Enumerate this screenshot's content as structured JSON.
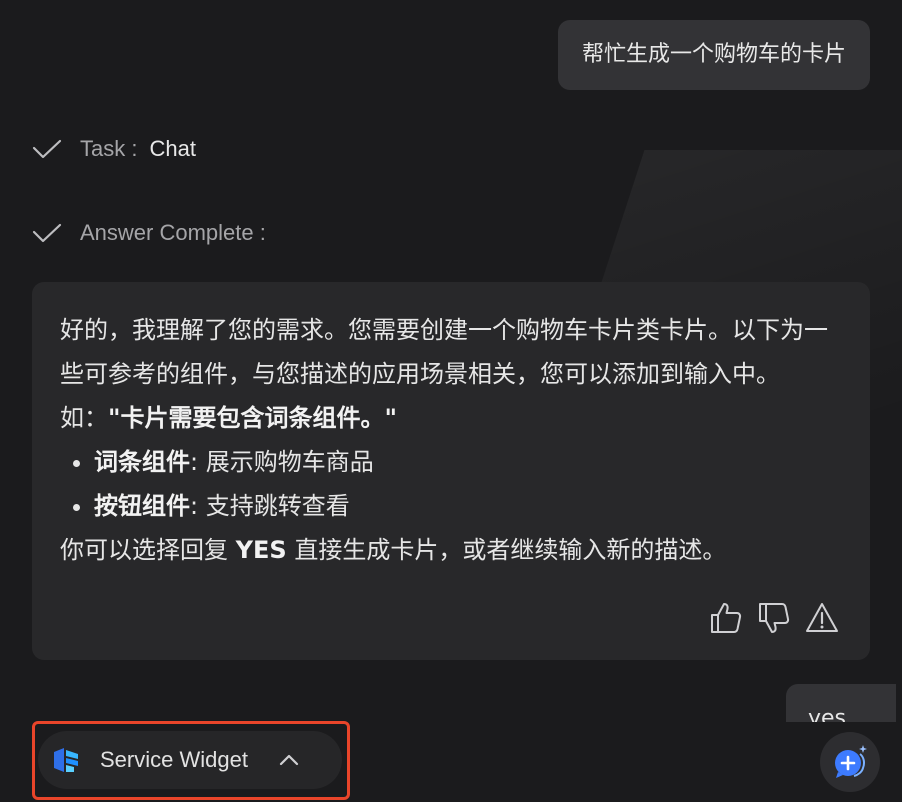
{
  "user_message": "帮忙生成一个购物车的卡片",
  "task_row": {
    "label": "Task :",
    "value": "Chat"
  },
  "answer_row": {
    "label": "Answer Complete :"
  },
  "answer": {
    "intro": "好的，我理解了您的需求。您需要创建一个购物车卡片类卡片。以下为一些可参考的组件，与您描述的应用场景相关，您可以添加到输入中。如：",
    "example_quote": "\"卡片需要包含词条组件。\"",
    "items": [
      {
        "name": "词条组件",
        "desc": ": 展示购物车商品"
      },
      {
        "name": "按钮组件",
        "desc": ": 支持跳转查看"
      }
    ],
    "outro_prefix": "你可以选择回复 ",
    "outro_keyword": "YES",
    "outro_suffix": " 直接生成卡片，或者继续输入新的描述。"
  },
  "feedback_icons": [
    "thumbs-up-icon",
    "thumbs-down-icon",
    "warning-icon"
  ],
  "user_message_2": "yes",
  "service_widget": {
    "label": "Service Widget"
  },
  "colors": {
    "background": "#1b1b1d",
    "bubble": "#333336",
    "card": "#28282a",
    "highlight": "#e9452a",
    "accent_blue": "#3d7bff"
  }
}
